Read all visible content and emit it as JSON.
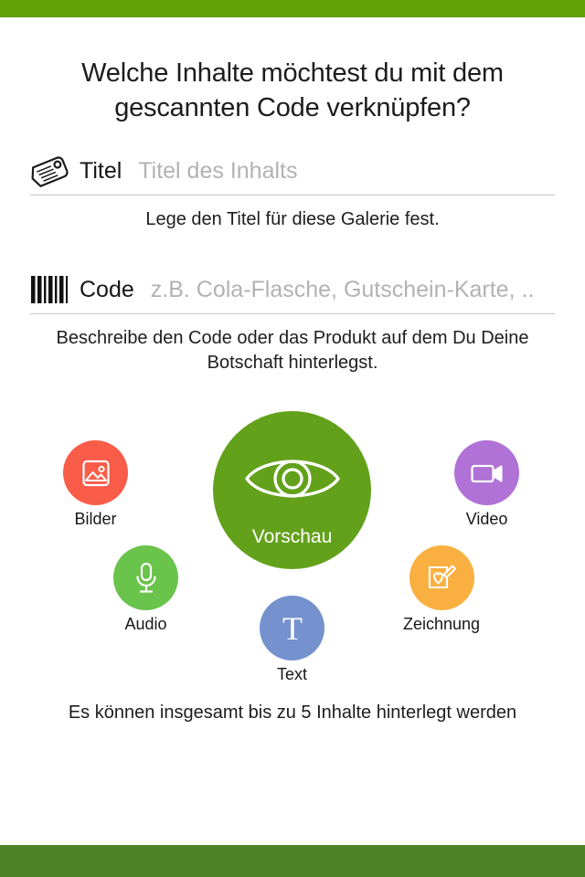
{
  "theme": {
    "topbar_color": "#63a003",
    "bottombar_color": "#4f8226",
    "preview_color": "#63a11b",
    "bilder_color": "#f95c49",
    "video_color": "#b072d6",
    "audio_color": "#6ac34a",
    "zeichnung_color": "#f9b041",
    "text_color": "#7591ce",
    "divider_color": "#c6c6c6",
    "placeholder_color": "#b2b2b2"
  },
  "header": {
    "title": "Welche Inhalte möchtest du mit dem gescannten Code verknüpfen?"
  },
  "form": {
    "title_field": {
      "icon": "tag-icon",
      "label": "Titel",
      "value": "",
      "placeholder": "Titel des Inhalts",
      "help": "Lege den Titel für diese Galerie fest."
    },
    "code_field": {
      "icon": "barcode-icon",
      "label": "Code",
      "value": "",
      "placeholder": "z.B. Cola-Flasche, Gutschein-Karte, ..",
      "help": "Beschreibe den Code oder das Produkt auf dem Du Deine Botschaft hinterlegst."
    }
  },
  "content_types": {
    "preview": {
      "label": "Vorschau",
      "icon": "eye-icon",
      "color": "#63a11b"
    },
    "items": [
      {
        "key": "bilder",
        "label": "Bilder",
        "icon": "image-icon",
        "color": "#f95c49"
      },
      {
        "key": "video",
        "label": "Video",
        "icon": "video-camera-icon",
        "color": "#b072d6"
      },
      {
        "key": "audio",
        "label": "Audio",
        "icon": "microphone-icon",
        "color": "#6ac34a"
      },
      {
        "key": "zeichnung",
        "label": "Zeichnung",
        "icon": "drawing-pencil-icon",
        "color": "#f9b041"
      },
      {
        "key": "text",
        "label": "Text",
        "icon": "letter-t-icon",
        "color": "#7591ce"
      }
    ]
  },
  "footer": {
    "note": "Es können insgesamt bis zu 5 Inhalte hinterlegt werden"
  }
}
